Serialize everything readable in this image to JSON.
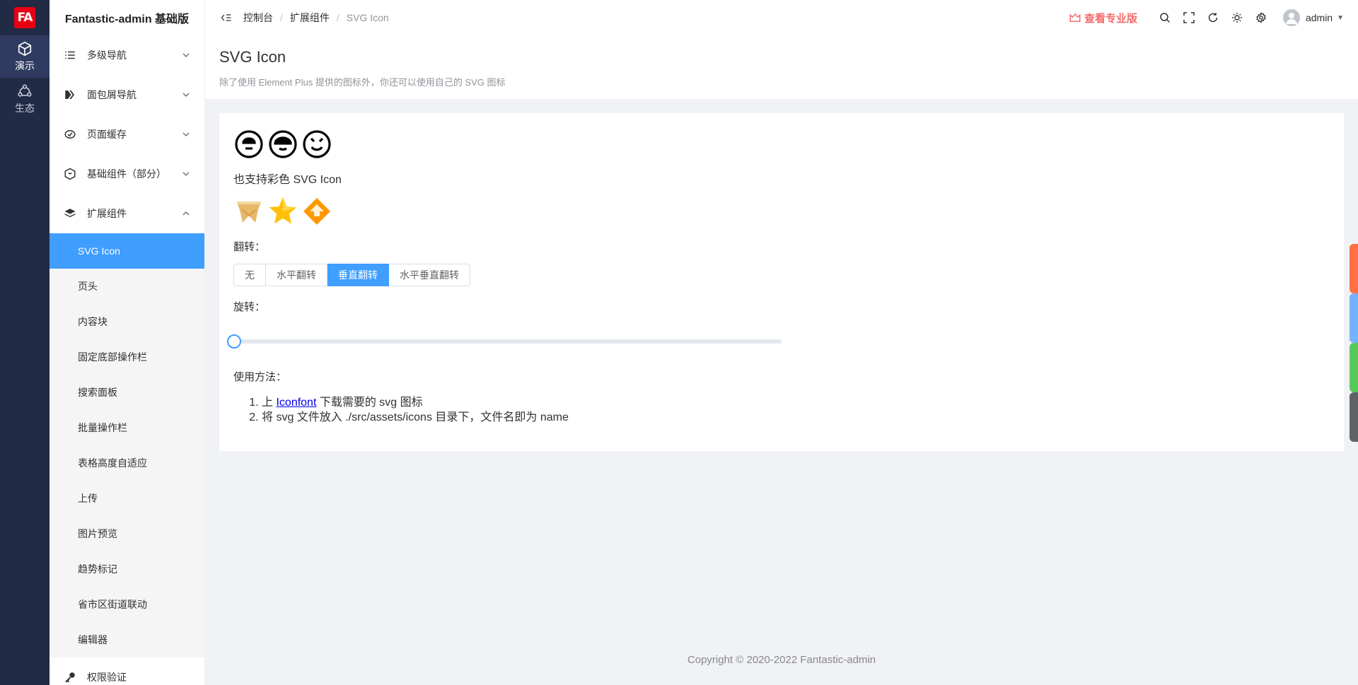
{
  "app": {
    "logo_text": "FA",
    "sub_title": "Fantastic-admin 基础版"
  },
  "main_nav": [
    {
      "label": "演示",
      "icon": "cube-icon",
      "active": true
    },
    {
      "label": "生态",
      "icon": "ecosystem-icon",
      "active": false
    }
  ],
  "sidebar": {
    "items": [
      {
        "label": "多级导航",
        "icon": "list-icon",
        "expanded": false
      },
      {
        "label": "面包屑导航",
        "icon": "breadcrumb-icon",
        "expanded": false
      },
      {
        "label": "页面缓存",
        "icon": "cache-icon",
        "expanded": false
      },
      {
        "label": "基础组件（部分）",
        "icon": "component-icon",
        "expanded": false
      },
      {
        "label": "扩展组件",
        "icon": "layers-icon",
        "expanded": true
      }
    ],
    "submenu": [
      {
        "label": "SVG Icon",
        "active": true
      },
      {
        "label": "页头"
      },
      {
        "label": "内容块"
      },
      {
        "label": "固定底部操作栏"
      },
      {
        "label": "搜索面板"
      },
      {
        "label": "批量操作栏"
      },
      {
        "label": "表格高度自适应"
      },
      {
        "label": "上传"
      },
      {
        "label": "图片预览"
      },
      {
        "label": "趋势标记"
      },
      {
        "label": "省市区街道联动"
      },
      {
        "label": "编辑器"
      }
    ],
    "last_item": {
      "label": "权限验证",
      "icon": "key-icon"
    }
  },
  "topbar": {
    "breadcrumb": [
      "控制台",
      "扩展组件",
      "SVG Icon"
    ],
    "separator": "/",
    "pro_link": "查看专业版",
    "user": "admin"
  },
  "page": {
    "title": "SVG Icon",
    "description": "除了使用 Element Plus 提供的图标外，你还可以使用自己的 SVG 图标"
  },
  "content": {
    "color_label": "也支持彩色 SVG Icon",
    "flip_label": "翻转：",
    "flip_options": [
      "无",
      "水平翻转",
      "垂直翻转",
      "水平垂直翻转"
    ],
    "flip_selected": "垂直翻转",
    "rotate_label": "旋转：",
    "rotate_value": 0,
    "usage_label": "使用方法：",
    "usage_1_prefix": "上",
    "usage_1_link": "Iconfont",
    "usage_1_suffix": "下载需要的 svg 图标",
    "usage_2": "将 svg 文件放入 ./src/assets/icons 目录下，文件名即为 name"
  },
  "footer": {
    "text": "Copyright © 2020-2022  Fantastic-admin"
  },
  "colors": {
    "accent": "#409eff",
    "sidebar_bg": "#222b45",
    "pro": "#f56c6c",
    "side_tabs": [
      "#ff7043",
      "#73b3ff",
      "#57c95a",
      "#5f6368"
    ]
  }
}
